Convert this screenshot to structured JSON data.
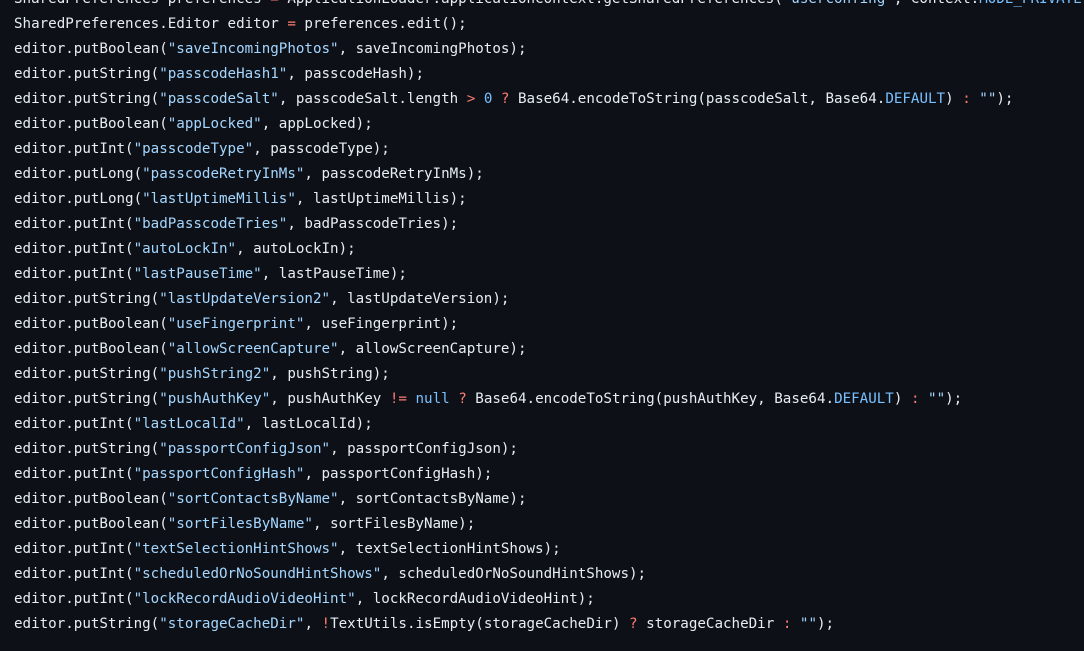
{
  "theme": {
    "background": "#0d1117",
    "colors": {
      "plain": "#e6edf3",
      "string": "#a5d6ff",
      "op": "#ff7b72",
      "const": "#79c0ff"
    }
  },
  "code": {
    "lines": [
      [
        [
          "plain",
          "SharedPreferences preferences "
        ],
        [
          "op",
          "="
        ],
        [
          "plain",
          " ApplicationLoader.applicationContext.getSharedPreferences("
        ],
        [
          "string",
          "\"userconfing\""
        ],
        [
          "plain",
          ", Context."
        ],
        [
          "const",
          "MODE_PRIVATE"
        ],
        [
          "plain",
          ");"
        ]
      ],
      [
        [
          "plain",
          "SharedPreferences.Editor editor "
        ],
        [
          "op",
          "="
        ],
        [
          "plain",
          " preferences.edit();"
        ]
      ],
      [
        [
          "plain",
          "editor.putBoolean("
        ],
        [
          "string",
          "\"saveIncomingPhotos\""
        ],
        [
          "plain",
          ", saveIncomingPhotos);"
        ]
      ],
      [
        [
          "plain",
          "editor.putString("
        ],
        [
          "string",
          "\"passcodeHash1\""
        ],
        [
          "plain",
          ", passcodeHash);"
        ]
      ],
      [
        [
          "plain",
          "editor.putString("
        ],
        [
          "string",
          "\"passcodeSalt\""
        ],
        [
          "plain",
          ", passcodeSalt.length "
        ],
        [
          "op",
          ">"
        ],
        [
          "plain",
          " "
        ],
        [
          "const",
          "0"
        ],
        [
          "plain",
          " "
        ],
        [
          "op",
          "?"
        ],
        [
          "plain",
          " Base64.encodeToString(passcodeSalt, Base64."
        ],
        [
          "const",
          "DEFAULT"
        ],
        [
          "plain",
          ") "
        ],
        [
          "op",
          ":"
        ],
        [
          "plain",
          " "
        ],
        [
          "string",
          "\"\""
        ],
        [
          "plain",
          ");"
        ]
      ],
      [
        [
          "plain",
          "editor.putBoolean("
        ],
        [
          "string",
          "\"appLocked\""
        ],
        [
          "plain",
          ", appLocked);"
        ]
      ],
      [
        [
          "plain",
          "editor.putInt("
        ],
        [
          "string",
          "\"passcodeType\""
        ],
        [
          "plain",
          ", passcodeType);"
        ]
      ],
      [
        [
          "plain",
          "editor.putLong("
        ],
        [
          "string",
          "\"passcodeRetryInMs\""
        ],
        [
          "plain",
          ", passcodeRetryInMs);"
        ]
      ],
      [
        [
          "plain",
          "editor.putLong("
        ],
        [
          "string",
          "\"lastUptimeMillis\""
        ],
        [
          "plain",
          ", lastUptimeMillis);"
        ]
      ],
      [
        [
          "plain",
          "editor.putInt("
        ],
        [
          "string",
          "\"badPasscodeTries\""
        ],
        [
          "plain",
          ", badPasscodeTries);"
        ]
      ],
      [
        [
          "plain",
          "editor.putInt("
        ],
        [
          "string",
          "\"autoLockIn\""
        ],
        [
          "plain",
          ", autoLockIn);"
        ]
      ],
      [
        [
          "plain",
          "editor.putInt("
        ],
        [
          "string",
          "\"lastPauseTime\""
        ],
        [
          "plain",
          ", lastPauseTime);"
        ]
      ],
      [
        [
          "plain",
          "editor.putString("
        ],
        [
          "string",
          "\"lastUpdateVersion2\""
        ],
        [
          "plain",
          ", lastUpdateVersion);"
        ]
      ],
      [
        [
          "plain",
          "editor.putBoolean("
        ],
        [
          "string",
          "\"useFingerprint\""
        ],
        [
          "plain",
          ", useFingerprint);"
        ]
      ],
      [
        [
          "plain",
          "editor.putBoolean("
        ],
        [
          "string",
          "\"allowScreenCapture\""
        ],
        [
          "plain",
          ", allowScreenCapture);"
        ]
      ],
      [
        [
          "plain",
          "editor.putString("
        ],
        [
          "string",
          "\"pushString2\""
        ],
        [
          "plain",
          ", pushString);"
        ]
      ],
      [
        [
          "plain",
          "editor.putString("
        ],
        [
          "string",
          "\"pushAuthKey\""
        ],
        [
          "plain",
          ", pushAuthKey "
        ],
        [
          "op",
          "!="
        ],
        [
          "plain",
          " "
        ],
        [
          "const",
          "null"
        ],
        [
          "plain",
          " "
        ],
        [
          "op",
          "?"
        ],
        [
          "plain",
          " Base64.encodeToString(pushAuthKey, Base64."
        ],
        [
          "const",
          "DEFAULT"
        ],
        [
          "plain",
          ") "
        ],
        [
          "op",
          ":"
        ],
        [
          "plain",
          " "
        ],
        [
          "string",
          "\"\""
        ],
        [
          "plain",
          ");"
        ]
      ],
      [
        [
          "plain",
          "editor.putInt("
        ],
        [
          "string",
          "\"lastLocalId\""
        ],
        [
          "plain",
          ", lastLocalId);"
        ]
      ],
      [
        [
          "plain",
          "editor.putString("
        ],
        [
          "string",
          "\"passportConfigJson\""
        ],
        [
          "plain",
          ", passportConfigJson);"
        ]
      ],
      [
        [
          "plain",
          "editor.putInt("
        ],
        [
          "string",
          "\"passportConfigHash\""
        ],
        [
          "plain",
          ", passportConfigHash);"
        ]
      ],
      [
        [
          "plain",
          "editor.putBoolean("
        ],
        [
          "string",
          "\"sortContactsByName\""
        ],
        [
          "plain",
          ", sortContactsByName);"
        ]
      ],
      [
        [
          "plain",
          "editor.putBoolean("
        ],
        [
          "string",
          "\"sortFilesByName\""
        ],
        [
          "plain",
          ", sortFilesByName);"
        ]
      ],
      [
        [
          "plain",
          "editor.putInt("
        ],
        [
          "string",
          "\"textSelectionHintShows\""
        ],
        [
          "plain",
          ", textSelectionHintShows);"
        ]
      ],
      [
        [
          "plain",
          "editor.putInt("
        ],
        [
          "string",
          "\"scheduledOrNoSoundHintShows\""
        ],
        [
          "plain",
          ", scheduledOrNoSoundHintShows);"
        ]
      ],
      [
        [
          "plain",
          "editor.putInt("
        ],
        [
          "string",
          "\"lockRecordAudioVideoHint\""
        ],
        [
          "plain",
          ", lockRecordAudioVideoHint);"
        ]
      ],
      [
        [
          "plain",
          "editor.putString("
        ],
        [
          "string",
          "\"storageCacheDir\""
        ],
        [
          "plain",
          ", "
        ],
        [
          "op",
          "!"
        ],
        [
          "plain",
          "TextUtils.isEmpty(storageCacheDir) "
        ],
        [
          "op",
          "?"
        ],
        [
          "plain",
          " storageCacheDir "
        ],
        [
          "op",
          ":"
        ],
        [
          "plain",
          " "
        ],
        [
          "string",
          "\"\""
        ],
        [
          "plain",
          ");"
        ]
      ]
    ]
  }
}
